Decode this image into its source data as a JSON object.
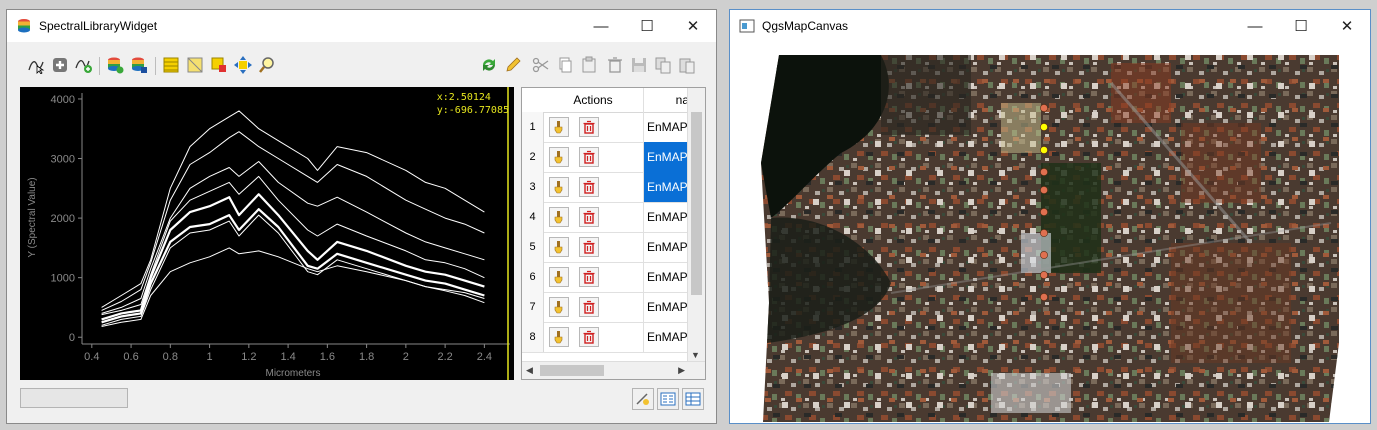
{
  "spectral_window": {
    "title": "SpectralLibraryWidget",
    "toolbar_left": [
      "select-profile-icon",
      "add-profile-icon",
      "add-profile-auto-icon",
      "import-library-icon",
      "export-library-icon",
      "attribute-table-icon",
      "toggle-editing-icon",
      "select-profile-icon-2",
      "move-to-selection-icon",
      "zoom-to-selection-icon"
    ],
    "toolbar_right": [
      "reload-icon",
      "edit-pencil-icon",
      "cut-icon",
      "copy-icon",
      "paste-icon",
      "delete-icon",
      "save-icon",
      "copy-table-icon",
      "paste-table-icon"
    ]
  },
  "plot": {
    "coord_x": "x:2.50124",
    "coord_y": "y:-696.77085",
    "cursor_color": "#e6e61e"
  },
  "chart_data": {
    "type": "line",
    "title": "",
    "xlabel": "Micrometers",
    "ylabel": "Y (Spectral Value)",
    "xlim": [
      0.35,
      2.5
    ],
    "ylim": [
      -80,
      4100
    ],
    "xticks": [
      0.4,
      0.6,
      0.8,
      1,
      1.2,
      1.4,
      1.6,
      1.8,
      2,
      2.2,
      2.4
    ],
    "xtick_labels": [
      "0.4",
      "0.6",
      "0.8",
      "1",
      "1.2",
      "1.4",
      "1.6",
      "1.8",
      "2",
      "2.2",
      "2.4"
    ],
    "yticks": [
      0,
      1000,
      2000,
      3000,
      4000
    ],
    "ytick_labels": [
      "0",
      "1000",
      "2000",
      "3000",
      "4000"
    ],
    "x": [
      0.45,
      0.55,
      0.65,
      0.7,
      0.8,
      0.9,
      1.0,
      1.1,
      1.15,
      1.25,
      1.35,
      1.5,
      1.55,
      1.65,
      1.8,
      2.0,
      2.1,
      2.2,
      2.3,
      2.4
    ],
    "series": [
      {
        "values": [
          500,
          700,
          900,
          1300,
          2500,
          3200,
          3500,
          3700,
          3800,
          3500,
          3300,
          3000,
          2800,
          3200,
          3100,
          2800,
          2600,
          2500,
          2300,
          2100
        ]
      },
      {
        "values": [
          450,
          600,
          800,
          1250,
          2300,
          2900,
          3100,
          3350,
          3450,
          3200,
          3000,
          2700,
          2600,
          2900,
          2700,
          2300,
          2150,
          2000,
          1900,
          1750
        ]
      },
      {
        "values": [
          400,
          500,
          650,
          1150,
          2000,
          2500,
          2700,
          2850,
          2700,
          2950,
          2600,
          2250,
          2200,
          2350,
          2100,
          1750,
          1600,
          1500,
          1400,
          1300
        ]
      },
      {
        "values": [
          380,
          450,
          550,
          1050,
          1950,
          2300,
          2450,
          2600,
          2400,
          2700,
          2300,
          1800,
          1700,
          1900,
          1700,
          1450,
          1300,
          1250,
          1150,
          1000
        ]
      },
      {
        "values": [
          300,
          400,
          450,
          1000,
          1800,
          2100,
          2200,
          2350,
          2050,
          2400,
          2050,
          1450,
          1300,
          1600,
          1450,
          1200,
          1100,
          1050,
          950,
          850
        ]
      },
      {
        "values": [
          250,
          350,
          400,
          900,
          1600,
          1850,
          1900,
          2050,
          1800,
          2150,
          1850,
          1200,
          1150,
          1400,
          1250,
          1050,
          950,
          900,
          800,
          700
        ]
      },
      {
        "values": [
          200,
          300,
          350,
          800,
          1500,
          1750,
          1800,
          1950,
          1700,
          2050,
          1750,
          1100,
          1050,
          1300,
          1150,
          950,
          850,
          780,
          700,
          580
        ]
      },
      {
        "values": [
          180,
          250,
          300,
          700,
          1100,
          1250,
          1350,
          1500,
          1400,
          1450,
          1350,
          1150,
          1100,
          1200,
          1100,
          950,
          850,
          800,
          750,
          650
        ]
      }
    ]
  },
  "table": {
    "headers": {
      "actions": "Actions",
      "name": "na"
    },
    "rows": [
      {
        "num": "1",
        "name": "EnMAP",
        "selected": false
      },
      {
        "num": "2",
        "name": "EnMAP",
        "selected": true
      },
      {
        "num": "3",
        "name": "EnMAP",
        "selected": true
      },
      {
        "num": "4",
        "name": "EnMAP",
        "selected": false
      },
      {
        "num": "5",
        "name": "EnMAP",
        "selected": false
      },
      {
        "num": "6",
        "name": "EnMAP",
        "selected": false
      },
      {
        "num": "7",
        "name": "EnMAP",
        "selected": false
      },
      {
        "num": "8",
        "name": "EnMAP",
        "selected": false
      }
    ]
  },
  "map_window": {
    "title": "QgsMapCanvas",
    "points_colors": [
      "#e07050",
      "#ffff00"
    ]
  },
  "window_buttons": {
    "minimize": "—",
    "maximize": "☐",
    "close": "✕"
  }
}
